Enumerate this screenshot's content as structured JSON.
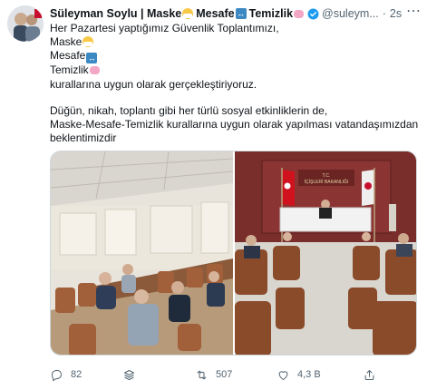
{
  "tweet": {
    "author_name": "Süleyman Soylu | Maske",
    "name_part2": "Mesafe",
    "name_part3": "Temizlik",
    "handle": "@suleym...",
    "separator": "·",
    "time": "2s",
    "more_icon": "more-dots-icon",
    "body_lines": [
      "Her Pazartesi yaptığımız Güvenlik Toplantımızı,",
      "Maske",
      "Mesafe",
      "Temizlik",
      "kurallarına uygun olarak gerçekleştiriyoruz."
    ],
    "body_paragraph2": [
      "Düğün, nikah, toplantı gibi her türlü sosyal etkinliklerin de,",
      "Maske-Mesafe-Temizlik kurallarına uygun olarak yapılması vatandaşımızdan",
      "beklentimizdir"
    ],
    "media": {
      "left_photo": "meeting-room-photo",
      "right_photo": "ministry-hall-photo",
      "banner_text": "T.C.\nİÇİŞLERİ BAKANLIĞI"
    }
  },
  "actions": {
    "reply": {
      "icon": "reply-icon",
      "count": "82"
    },
    "stack": {
      "icon": "layers-icon",
      "count": ""
    },
    "retweet": {
      "icon": "retweet-icon",
      "count": "507"
    },
    "like": {
      "icon": "heart-icon",
      "count": "4,3 B"
    },
    "share": {
      "icon": "share-icon",
      "count": ""
    }
  },
  "colors": {
    "text": "#0f1419",
    "secondary": "#536471",
    "verified": "#1d9bf0",
    "border": "#cfd9de"
  }
}
